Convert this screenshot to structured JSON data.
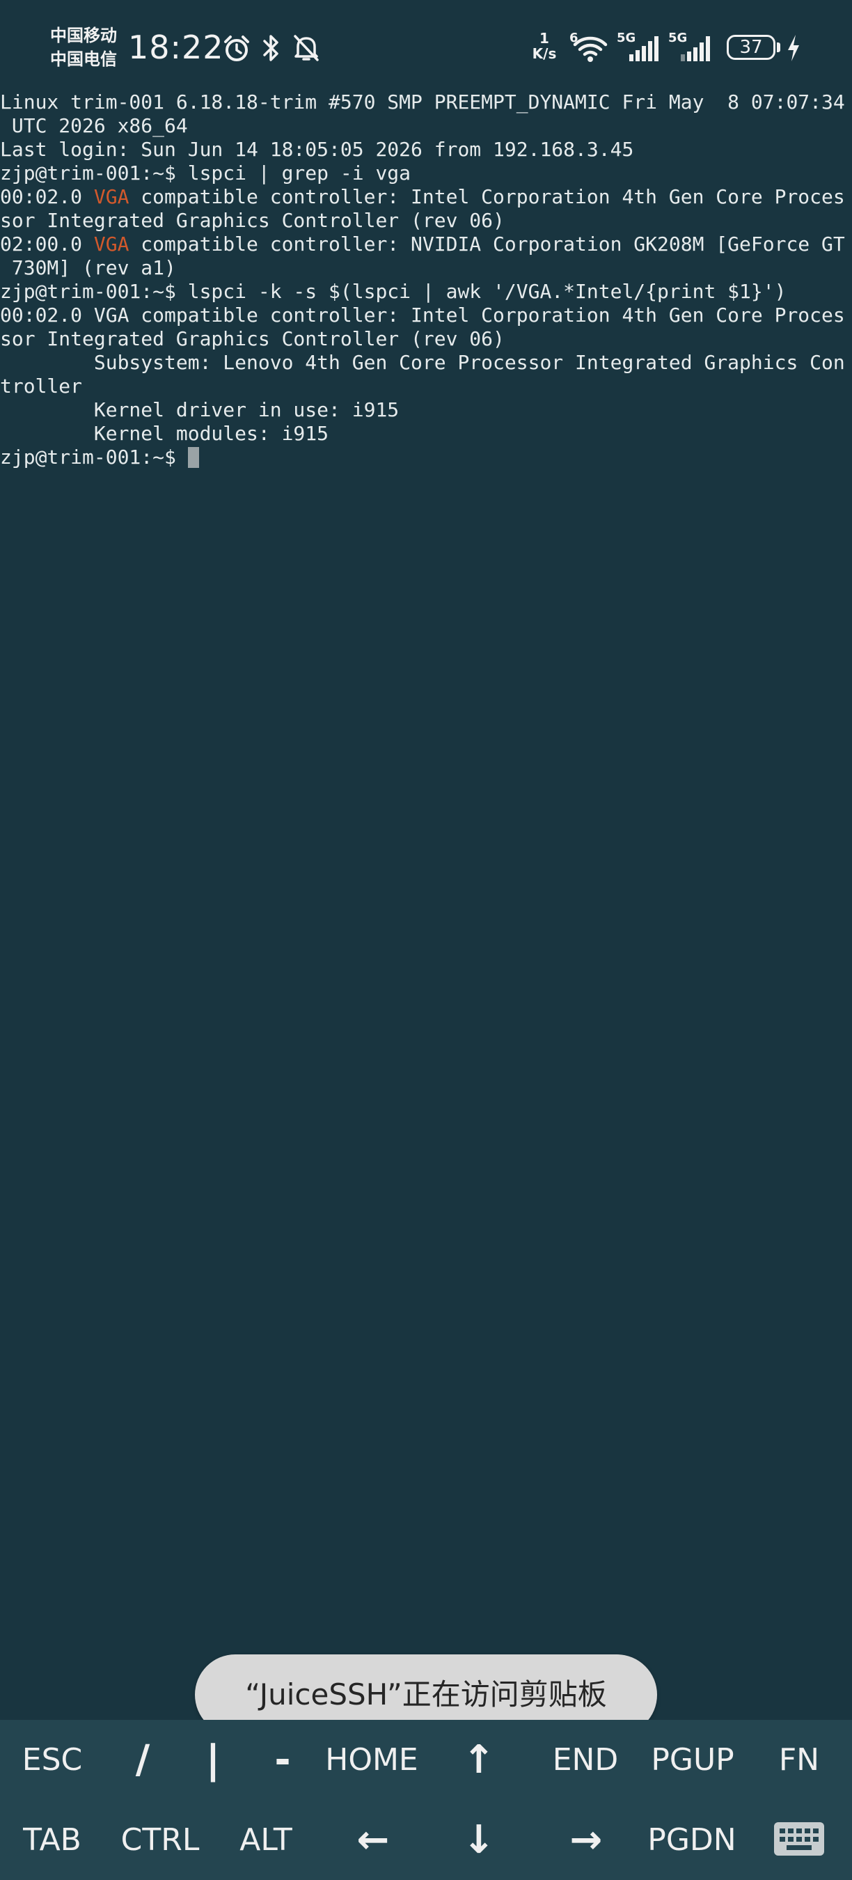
{
  "status_bar": {
    "carrier_1": "中国移动",
    "carrier_2": "中国电信",
    "time": "18:22",
    "net_speed_value": "1",
    "net_speed_unit": "K/s",
    "sim1_tag": "5G",
    "sim2_tag": "5G",
    "wifi_tag": "6",
    "battery_level": "37",
    "icons": [
      "alarm-icon",
      "bluetooth-icon",
      "notifications-off-icon",
      "wifi-icon",
      "signal-icon",
      "signal-icon",
      "battery-icon",
      "charging-icon"
    ]
  },
  "terminal": {
    "lines": [
      [
        {
          "t": "Linux trim-001 6.18.18-trim #570 SMP PREEMPT_DYNAMIC Fri May  8 07:07:34"
        }
      ],
      [
        {
          "t": " UTC 2026 x86_64"
        }
      ],
      [
        {
          "t": "Last login: Sun Jun 14 18:05:05 2026 from 192.168.3.45"
        }
      ],
      [
        {
          "t": "zjp@trim-001:~$ lspci | grep -i vga"
        }
      ],
      [
        {
          "t": "00:02.0 "
        },
        {
          "t": "VGA",
          "hl": true
        },
        {
          "t": " compatible controller: Intel Corporation 4th Gen Core Proces"
        }
      ],
      [
        {
          "t": "sor Integrated Graphics Controller (rev 06)"
        }
      ],
      [
        {
          "t": "02:00.0 "
        },
        {
          "t": "VGA",
          "hl": true
        },
        {
          "t": " compatible controller: NVIDIA Corporation GK208M [GeForce GT"
        }
      ],
      [
        {
          "t": " 730M] (rev a1)"
        }
      ],
      [
        {
          "t": "zjp@trim-001:~$ lspci -k -s $(lspci | awk '/VGA.*Intel/{print $1}')"
        }
      ],
      [
        {
          "t": "00:02.0 VGA compatible controller: Intel Corporation 4th Gen Core Proces"
        }
      ],
      [
        {
          "t": "sor Integrated Graphics Controller (rev 06)"
        }
      ],
      [
        {
          "t": "        Subsystem: Lenovo 4th Gen Core Processor Integrated Graphics Con"
        }
      ],
      [
        {
          "t": "troller"
        }
      ],
      [
        {
          "t": "        Kernel driver in use: i915"
        }
      ],
      [
        {
          "t": "        Kernel modules: i915"
        }
      ]
    ],
    "prompt": "zjp@trim-001:~$ "
  },
  "toast": {
    "text": "“JuiceSSH”正在访问剪贴板"
  },
  "keybar": {
    "row1": [
      "ESC",
      "/",
      "|",
      "-",
      "HOME",
      "↑",
      "END",
      "PGUP",
      "FN"
    ],
    "row2": [
      "TAB",
      "CTRL",
      "ALT",
      "←",
      "↓",
      "→",
      "PGDN"
    ],
    "keyboard_icon": "keyboard-icon"
  },
  "colors": {
    "background": "#193540",
    "keybar": "#244550",
    "highlight": "#d2592c",
    "toast": "#d8d8d8"
  }
}
